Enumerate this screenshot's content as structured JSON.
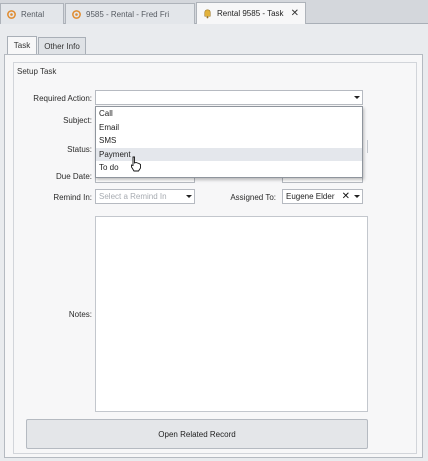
{
  "colors": {
    "tab_icon": "#e08a2c",
    "panel_bg": "#f7f7f8",
    "dropdown_hover": "#e4e7ec"
  },
  "doc_tabs": [
    {
      "label": "Rental",
      "icon": "gear-icon"
    },
    {
      "label": "9585 - Rental - Fred Fri",
      "icon": "gear-icon"
    },
    {
      "label": "Rental 9585 - Task",
      "icon": "bell-icon",
      "close": "✕"
    }
  ],
  "inner_tabs": [
    "Task",
    "Other Info"
  ],
  "group_title": "Setup Task",
  "labels": {
    "required_action": "Required Action:",
    "subject": "Subject:",
    "status": "Status:",
    "due_date": "Due Date:",
    "remind_in": "Remind In:",
    "assigned_to": "Assigned To:",
    "notes": "Notes:"
  },
  "fields": {
    "required_action_value": "",
    "due_date_value": "",
    "remind_in_placeholder": "Select a Remind In",
    "assigned_to_value": "Eugene Elder",
    "clear": "✕"
  },
  "dropdown": {
    "options": [
      "Call",
      "Email",
      "SMS",
      "Payment",
      "To do"
    ],
    "hovered": "Payment"
  },
  "buttons": {
    "open_related": "Open Related Record"
  }
}
